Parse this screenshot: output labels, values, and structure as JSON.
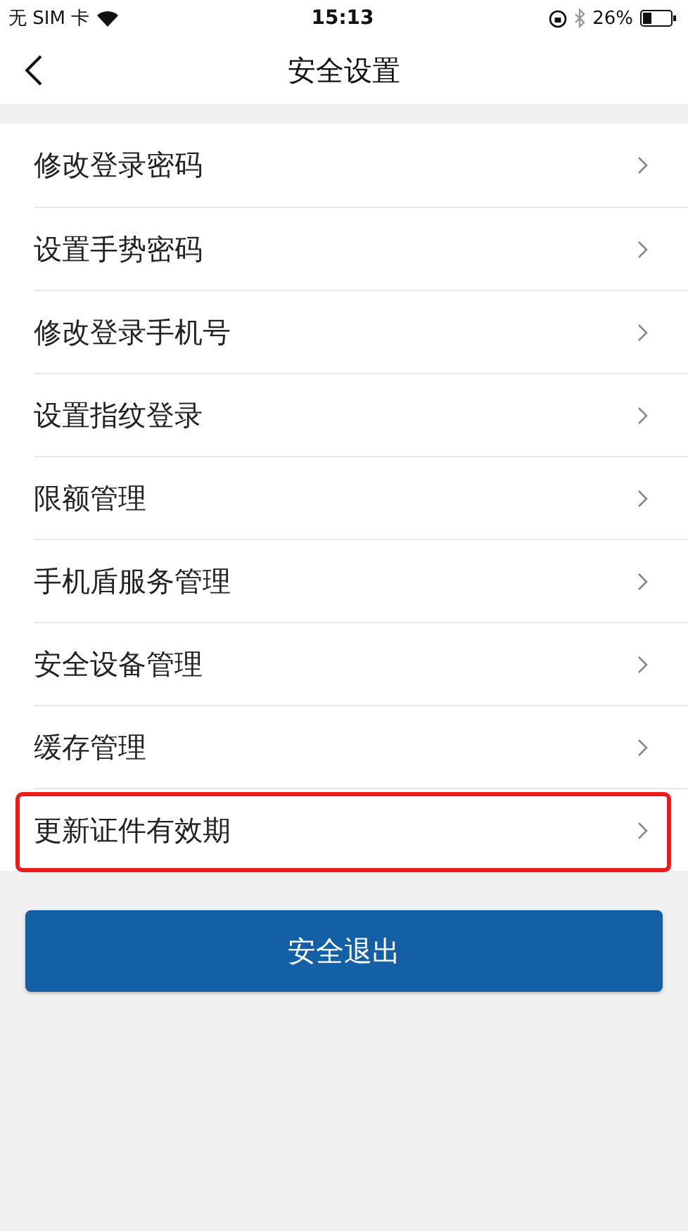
{
  "status_bar": {
    "carrier": "无 SIM 卡",
    "time": "15:13",
    "battery": "26%"
  },
  "nav": {
    "title": "安全设置"
  },
  "menu_items": [
    {
      "label": "修改登录密码",
      "highlighted": false
    },
    {
      "label": "设置手势密码",
      "highlighted": false
    },
    {
      "label": "修改登录手机号",
      "highlighted": false
    },
    {
      "label": "设置指纹登录",
      "highlighted": false
    },
    {
      "label": "限额管理",
      "highlighted": false
    },
    {
      "label": "手机盾服务管理",
      "highlighted": false
    },
    {
      "label": "安全设备管理",
      "highlighted": false
    },
    {
      "label": "缓存管理",
      "highlighted": false
    },
    {
      "label": "更新证件有效期",
      "highlighted": true
    }
  ],
  "logout_button": "安全退出"
}
